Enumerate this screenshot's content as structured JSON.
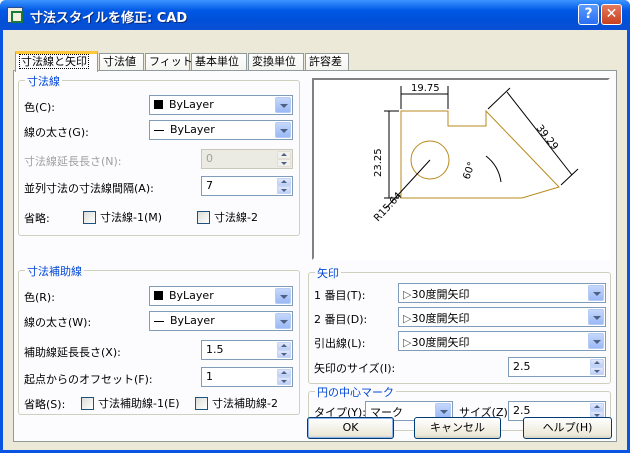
{
  "window": {
    "title": "寸法スタイルを修正: CAD",
    "help_btn": "?",
    "close_btn": "✕"
  },
  "tabs": [
    "寸法線と矢印",
    "寸法値",
    "フィット",
    "基本単位",
    "変換単位",
    "許容差"
  ],
  "dim_line": {
    "group": "寸法線",
    "color_label": "色(C):",
    "color_value": "ByLayer",
    "weight_label": "線の太さ(G):",
    "weight_value": "ByLayer",
    "ext_label": "寸法線延長長さ(N):",
    "ext_value": "0",
    "spacing_label": "並列寸法の寸法線間隔(A):",
    "spacing_value": "7",
    "suppress_label": "省略:",
    "suppress1": "寸法線-1(M)",
    "suppress2": "寸法線-2"
  },
  "ext_line": {
    "group": "寸法補助線",
    "color_label": "色(R):",
    "color_value": "ByLayer",
    "weight_label": "線の太さ(W):",
    "weight_value": "ByLayer",
    "ext_label": "補助線延長長さ(X):",
    "ext_value": "1.5",
    "offset_label": "起点からのオフセット(F):",
    "offset_value": "1",
    "suppress_label": "省略(S):",
    "suppress1": "寸法補助線-1(E)",
    "suppress2": "寸法補助線-2"
  },
  "preview": {
    "dim_top": "19.75",
    "dim_left": "23.25",
    "dim_right": "39.29",
    "angle": "60°",
    "radius": "R15.64"
  },
  "arrowheads": {
    "group": "矢印",
    "first_label": "1 番目(T):",
    "first_value": "30度開矢印",
    "second_label": "2 番目(D):",
    "second_value": "30度開矢印",
    "leader_label": "引出線(L):",
    "leader_value": "30度開矢印",
    "size_label": "矢印のサイズ(I):",
    "size_value": "2.5"
  },
  "center": {
    "group": "円の中心マーク",
    "type_label": "タイプ(Y):",
    "type_value": "マーク",
    "size_label": "サイズ(Z):",
    "size_value": "2.5"
  },
  "buttons": {
    "ok": "OK",
    "cancel": "キャンセル",
    "help": "ヘルプ(H)"
  }
}
